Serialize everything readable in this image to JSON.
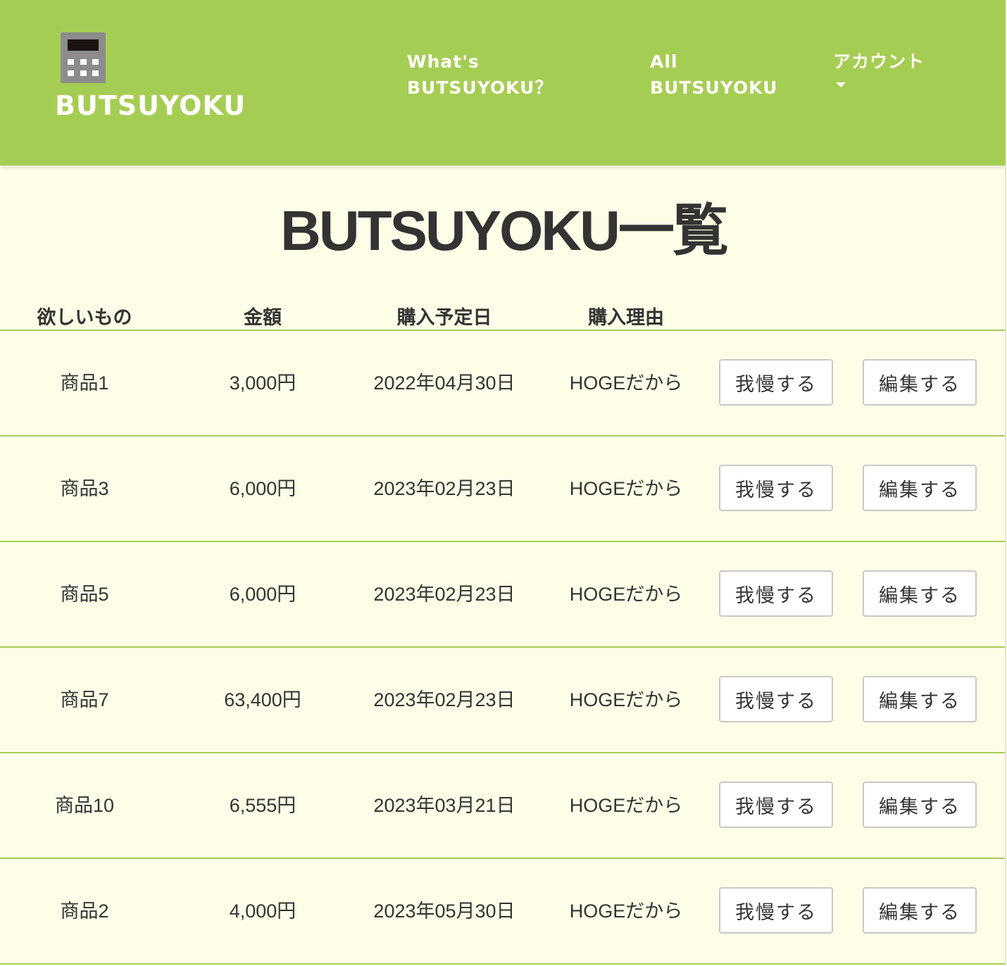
{
  "header": {
    "brand": "BUTSUYOKU",
    "brand_icon": "calculator-icon",
    "nav": {
      "whats_line1": "What's",
      "whats_line2": "BUTSUYOKU？",
      "all_line1": "All",
      "all_line2": "BUTSUYOKU",
      "account": "アカウント"
    },
    "colors": {
      "bar": "#a6cd53",
      "text": "#ffffff"
    }
  },
  "page": {
    "title": "BUTSUYOKU一覧",
    "background": "#fefee8"
  },
  "table": {
    "headers": {
      "item": "欲しいもの",
      "price": "金額",
      "date": "購入予定日",
      "reason": "購入理由"
    },
    "rows": [
      {
        "item": "商品1",
        "price": "3,000円",
        "date": "2022年04月30日",
        "reason": "HOGEだから",
        "gaman": "我慢する",
        "edit": "編集する"
      },
      {
        "item": "商品3",
        "price": "6,000円",
        "date": "2023年02月23日",
        "reason": "HOGEだから",
        "gaman": "我慢する",
        "edit": "編集する"
      },
      {
        "item": "商品5",
        "price": "6,000円",
        "date": "2023年02月23日",
        "reason": "HOGEだから",
        "gaman": "我慢する",
        "edit": "編集する"
      },
      {
        "item": "商品7",
        "price": "63,400円",
        "date": "2023年02月23日",
        "reason": "HOGEだから",
        "gaman": "我慢する",
        "edit": "編集する"
      },
      {
        "item": "商品10",
        "price": "6,555円",
        "date": "2023年03月21日",
        "reason": "HOGEだから",
        "gaman": "我慢する",
        "edit": "編集する"
      },
      {
        "item": "商品2",
        "price": "4,000円",
        "date": "2023年05月30日",
        "reason": "HOGEだから",
        "gaman": "我慢する",
        "edit": "編集する"
      }
    ]
  }
}
